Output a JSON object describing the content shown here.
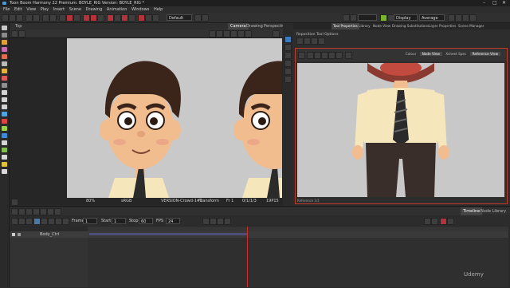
{
  "window": {
    "title": "Toon Boom Harmony 22 Premium: BOYLE_RIG Version: BOYLE_RIG *",
    "controls": [
      "–",
      "□",
      "✕"
    ]
  },
  "menu": [
    "File",
    "Edit",
    "View",
    "Play",
    "Insert",
    "Scene",
    "Drawing",
    "Animation",
    "Windows",
    "Help"
  ],
  "toolbar": {
    "workspace_value": "Default",
    "display_value": "Display",
    "average_value": "Average"
  },
  "camera_view": {
    "tabs": [
      "Camera",
      "Drawing",
      "Perspective"
    ],
    "tab_top": "Top",
    "status": {
      "zoom": "80%",
      "color_space": "sRGB",
      "drawing_name": "VERSION-Crowd-1#1",
      "mode": "Transform",
      "layer": "Fr 1",
      "frame": "0/1/1/3",
      "misc": "19P15"
    }
  },
  "right_panel": {
    "tabs": [
      "Tool Properties",
      "Library",
      "Node View",
      "Drawing Substitutions",
      "Layer Properties",
      "Scene Manager"
    ],
    "subtitle": "Reposition Tool Options",
    "ref_tabs": [
      "Colour",
      "Node View",
      "Xsheet Spec",
      "Reference View"
    ],
    "ref_status": "Reference  1/1"
  },
  "timeline": {
    "frame_label": "Frame",
    "frame_value": "1",
    "start_label": "Start",
    "start_value": "1",
    "stop_label": "Stop",
    "stop_value": "60",
    "fps_label": "FPS",
    "fps_value": "24",
    "tabs": [
      "Timeline",
      "Node Library"
    ],
    "layer_name": "Body_Ctrl"
  },
  "colors": {
    "accent_red": "#c0392b",
    "play_blue": "#2f80ed",
    "canvas_gray": "#c8c8c8",
    "skin": "#f1bd8f",
    "hair": "#3b2419",
    "shirt": "#f6e6bb",
    "pants": "#3a2e2b"
  },
  "watermark": "Udemy"
}
